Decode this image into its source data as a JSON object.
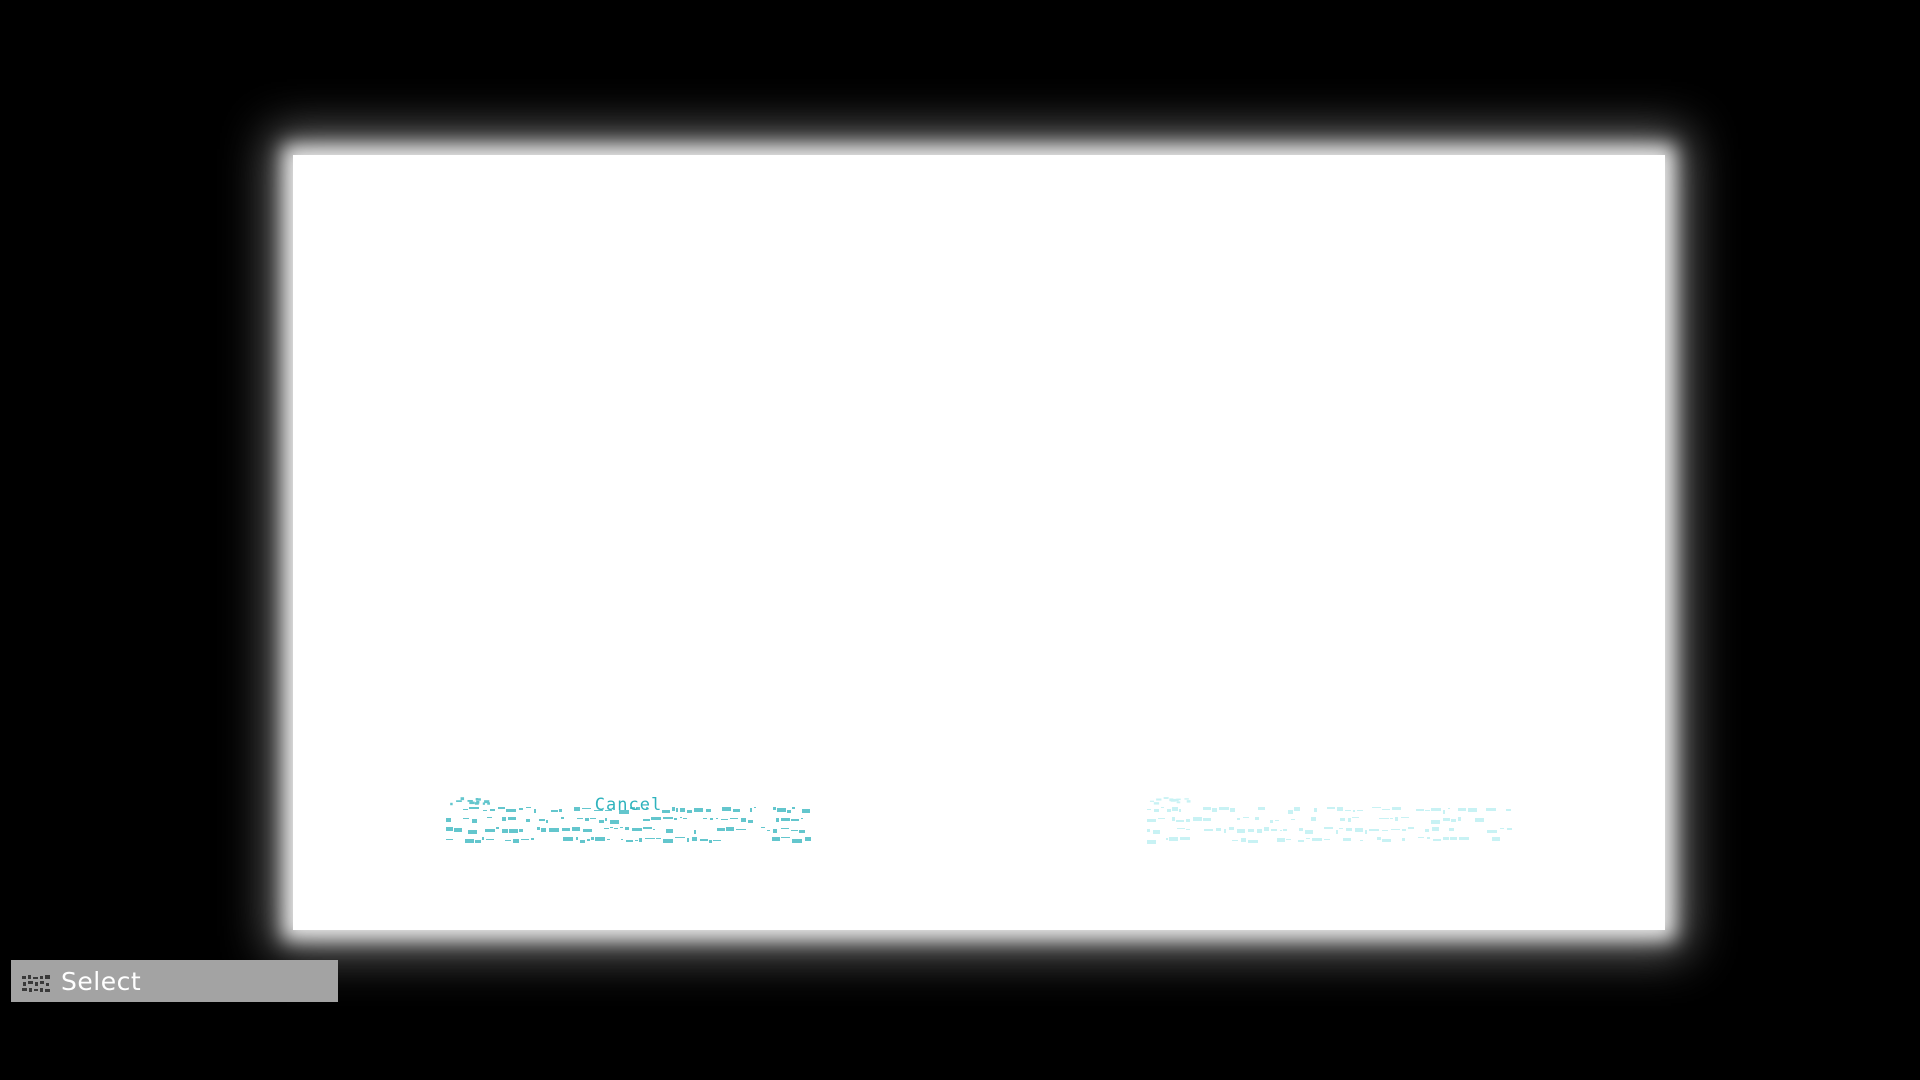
{
  "dialog": {
    "option_left": {
      "label": "Cancel",
      "color": "#2fb3bd"
    },
    "option_right": {
      "label": "",
      "color": "#bff0f3"
    }
  },
  "prompt": {
    "icon": "controller-button-icon",
    "label": "Select"
  },
  "colors": {
    "background": "#000000",
    "panel": "#ffffff",
    "prompt_bar": "#a3a3a3",
    "accent": "#2fb3bd"
  }
}
